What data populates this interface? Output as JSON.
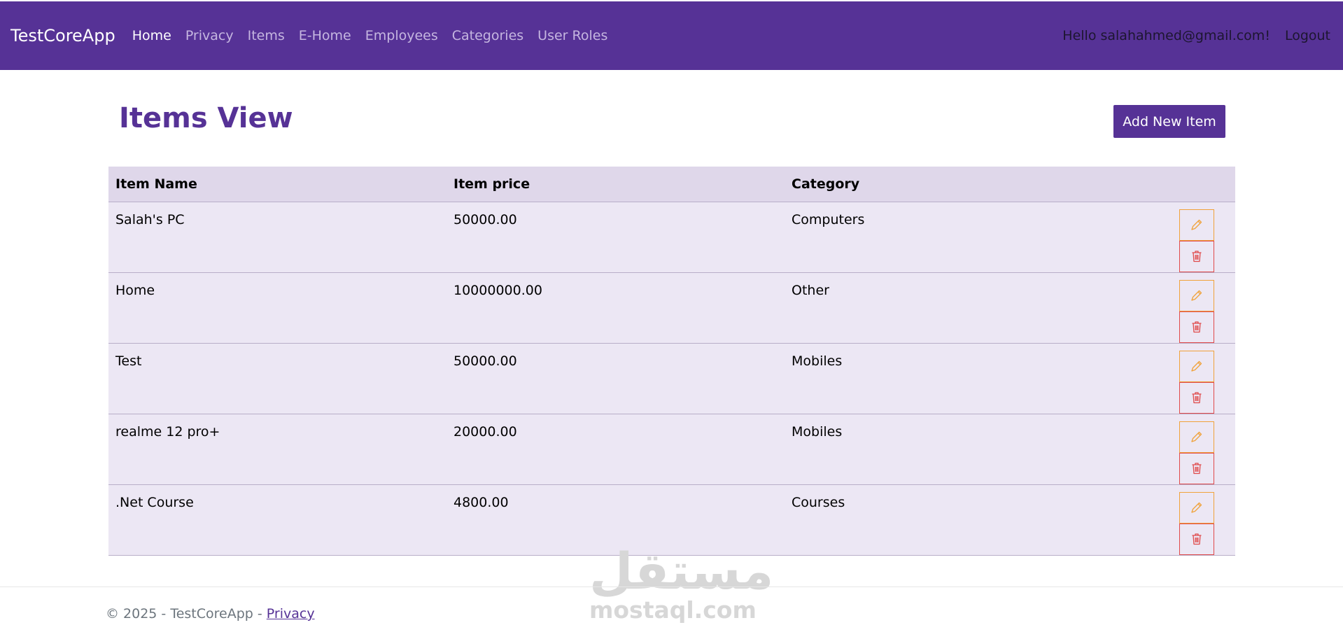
{
  "navbar": {
    "brand": "TestCoreApp",
    "links": [
      {
        "label": "Home",
        "active": true
      },
      {
        "label": "Privacy",
        "active": false
      },
      {
        "label": "Items",
        "active": false
      },
      {
        "label": "E-Home",
        "active": false
      },
      {
        "label": "Employees",
        "active": false
      },
      {
        "label": "Categories",
        "active": false
      },
      {
        "label": "User Roles",
        "active": false
      }
    ],
    "greeting": "Hello salahahmed@gmail.com!",
    "logout": "Logout"
  },
  "main": {
    "title": "Items View",
    "add_button": "Add New Item",
    "table": {
      "headers": [
        "Item Name",
        "Item price",
        "Category",
        ""
      ],
      "rows": [
        {
          "name": "Salah's PC",
          "price": "50000.00",
          "category": "Computers"
        },
        {
          "name": "Home",
          "price": "10000000.00",
          "category": "Other"
        },
        {
          "name": "Test",
          "price": "50000.00",
          "category": "Mobiles"
        },
        {
          "name": "realme 12 pro+",
          "price": "20000.00",
          "category": "Mobiles"
        },
        {
          "name": ".Net Course",
          "price": "4800.00",
          "category": "Courses"
        }
      ]
    }
  },
  "footer": {
    "text": "© 2025 - TestCoreApp - ",
    "privacy_link": "Privacy"
  },
  "watermark": {
    "arabic": "مستقل",
    "latin": "mostaql.com"
  },
  "colors": {
    "primary": "#563296",
    "header_row": "#dfd7ea",
    "body_row": "#ece7f4",
    "edit": "#f0a23a",
    "delete": "#e04a4a"
  },
  "icons": {
    "edit": "pencil-icon",
    "delete": "trash-icon"
  }
}
